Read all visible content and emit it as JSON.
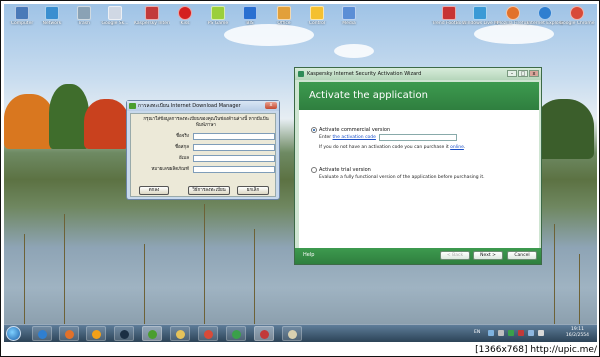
{
  "desktop_icons_left": [
    {
      "label": "Computer",
      "icon": "computer-icon",
      "color": "#4a79b8"
    },
    {
      "label": "Network",
      "icon": "network-icon",
      "color": "#3a8fd0"
    },
    {
      "label": "Trash",
      "icon": "recycle-bin-icon",
      "color": "#8aa2b5"
    },
    {
      "label": "Google Sk...",
      "icon": "sketchup-icon",
      "color": "#d0d8e4"
    },
    {
      "label": "Kaspersky Internet Se...",
      "icon": "kaspersky-icon",
      "color": "#c23a3a"
    },
    {
      "label": "Kiss",
      "icon": "kiss-icon",
      "color": "#d42020"
    },
    {
      "label": "PS Game",
      "icon": "game-icon",
      "color": "#9bcf3a"
    },
    {
      "label": "BIS",
      "icon": "bis-icon",
      "color": "#2a6fd1"
    },
    {
      "label": "Office",
      "icon": "office-icon",
      "color": "#e2a03a"
    },
    {
      "label": "Control",
      "icon": "control-icon",
      "color": "#f4c030"
    },
    {
      "label": "Media",
      "icon": "media-icon",
      "color": "#5b8ed6"
    }
  ],
  "desktop_icons_right": [
    {
      "label": "Trend FootBo...",
      "icon": "game-icon",
      "color": "#c73434"
    },
    {
      "label": "Windows Live Messe...",
      "icon": "messenger-icon",
      "color": "#3a9ad6"
    },
    {
      "label": "Mozilla Firefox",
      "icon": "firefox-icon",
      "color": "#e2712a"
    },
    {
      "label": "Internet Explorer",
      "icon": "ie-icon",
      "color": "#2f7fd0"
    },
    {
      "label": "Google Chrome",
      "icon": "chrome-icon",
      "color": "#d84a38"
    }
  ],
  "idm": {
    "title": "การลงทะเบียน Internet Download Manager",
    "close": "x",
    "info": "กรุณาใส่ข้อมูลการลงทะเบียนของคุณในช่องด้านล่างนี้ หากมีแป้นพิมพ์ภาษา",
    "fields": [
      {
        "label": "ชื่อจริง"
      },
      {
        "label": "ชื่อสกุล"
      },
      {
        "label": "อีเมล"
      },
      {
        "label": "หมายเลขผลิตภัณฑ์"
      }
    ],
    "buttons": {
      "ok": "ตกลง",
      "help": "วิธีการลงทะเบียน",
      "cancel": "ยกเลิก"
    }
  },
  "kaspersky": {
    "title": "Kaspersky Internet Security Activation Wizard",
    "heading": "Activate the application",
    "commercial": {
      "label": "Activate commercial version",
      "enter_prefix": "Enter",
      "enter_link": "the activation code",
      "hint_prefix": "If you do not have an activation code you can purchase it",
      "hint_link": "online",
      "hint_suffix": "."
    },
    "trial": {
      "label": "Activate trial version",
      "desc": "Evaluate a fully functional version of the application before purchasing it."
    },
    "footer": {
      "help": "Help",
      "back": "< Back",
      "next": "Next >",
      "cancel": "Cancel"
    }
  },
  "taskbar": {
    "lang": "EN",
    "time": "19:11",
    "date": "16/2/2554"
  },
  "watermark": "[1366x768]  http://upic.me/"
}
